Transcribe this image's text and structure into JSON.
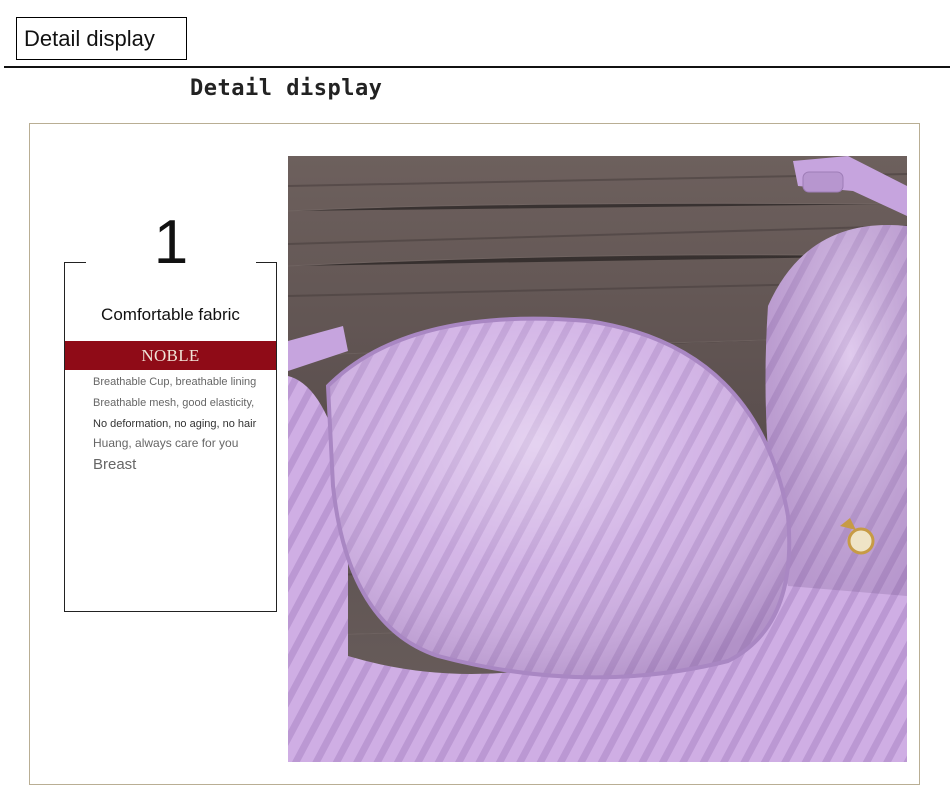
{
  "header": {
    "tab_label": "Detail display",
    "heading": "Detail display"
  },
  "feature": {
    "number": "1",
    "title": "Comfortable fabric",
    "badge": "NOBLE",
    "lines": [
      "Breathable Cup, breathable lining",
      "Breathable mesh, good elasticity,",
      "No deformation, no aging, no hair",
      "Huang, always care for you",
      "Breast"
    ]
  },
  "colors": {
    "badge_background": "#8f0b17",
    "frame_border": "#b9ae94",
    "product_color": "#c9a7df",
    "wood_background": "#5e5250"
  },
  "image": {
    "alt": "",
    "icon": "product-photo-icon"
  }
}
